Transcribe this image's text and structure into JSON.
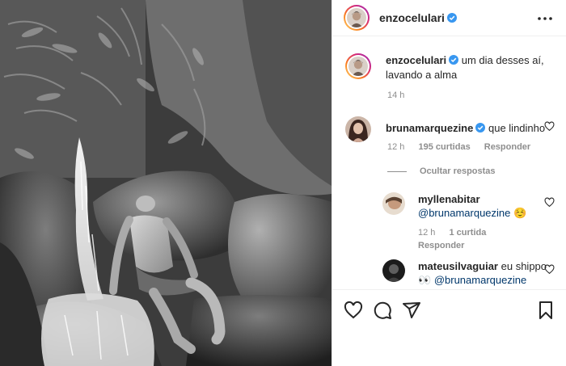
{
  "post": {
    "username": "enzocelulari",
    "caption": "um dia desses aí, lavando a alma",
    "time": "14 h"
  },
  "comments": [
    {
      "username": "brunamarquezine",
      "text": "que lindinho",
      "time": "12 h",
      "likes": "195 curtidas",
      "reply_label": "Responder"
    }
  ],
  "hide_replies_label": "Ocultar respostas",
  "replies": [
    {
      "username": "myllenabitar",
      "mention": "@brunamarquezine",
      "text": " ☺️",
      "time": "12 h",
      "likes": "1 curtida",
      "reply_label": "Responder"
    },
    {
      "username": "mateusilvaguiar",
      "text_before": "eu shippo",
      "text_middle": "👀",
      "mention": "@brunamarquezine"
    }
  ],
  "icons": {
    "more": "more-horizontal-icon",
    "like": "heart-icon",
    "comment": "comment-icon",
    "share": "direct-share-icon",
    "save": "bookmark-icon",
    "verified": "verified-badge-icon"
  },
  "colors": {
    "verified": "#3897f0",
    "mention": "#00376b",
    "secondary_text": "#8e8e8e",
    "divider": "#efefef"
  }
}
